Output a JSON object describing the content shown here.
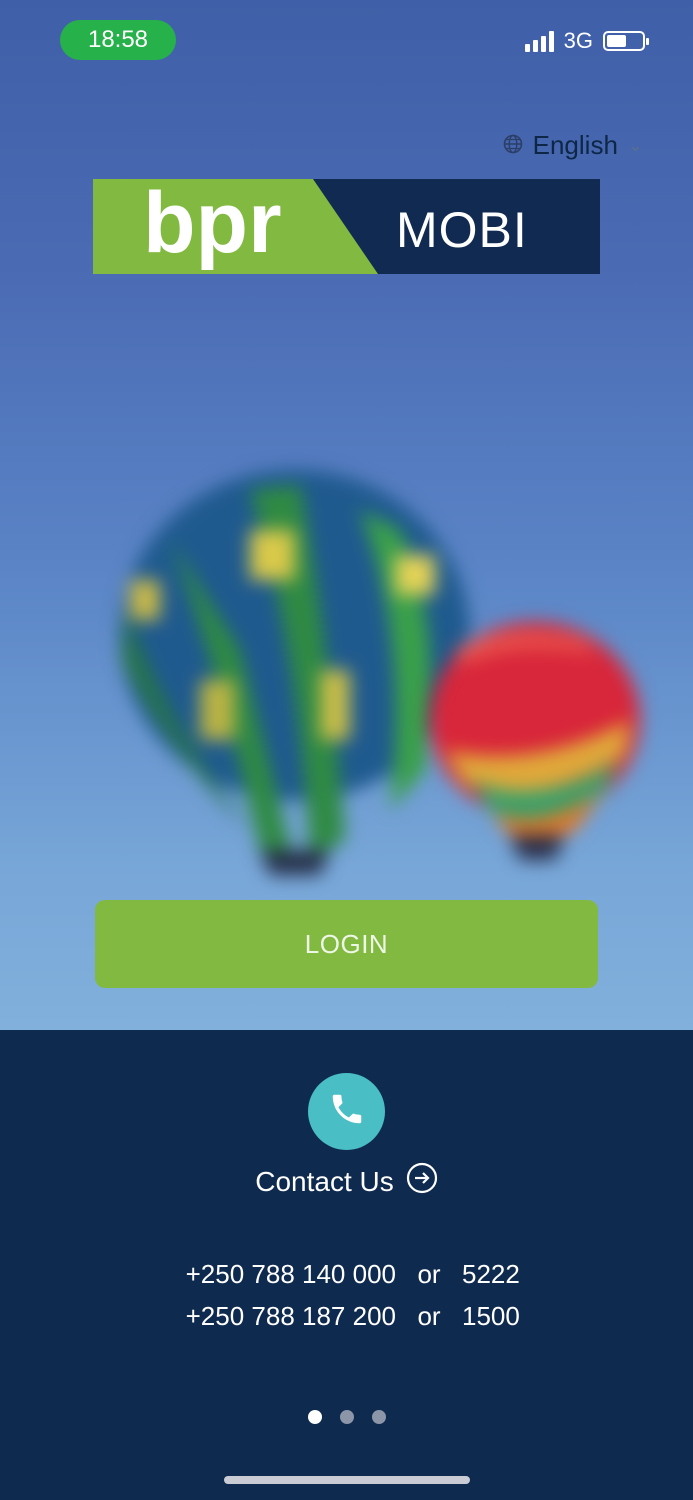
{
  "status_bar": {
    "time": "18:58",
    "network": "3G",
    "battery_level": 0.55
  },
  "language": {
    "icon": "globe-icon",
    "label": "English"
  },
  "logo": {
    "left_text": "bpr",
    "right_text": "MOBI"
  },
  "login": {
    "label": "LOGIN"
  },
  "contact": {
    "icon": "phone-icon",
    "label": "Contact Us",
    "arrow_icon": "arrow-right-circle-icon"
  },
  "phones": [
    {
      "number": "+250 788 140 000",
      "or": "or",
      "short": "5222"
    },
    {
      "number": "+250 788 187 200",
      "or": "or",
      "short": "1500"
    }
  ],
  "pager": {
    "count": 3,
    "active_index": 0
  },
  "colors": {
    "brand_green": "#82b941",
    "navy": "#0f2a4f",
    "teal": "#49bec4",
    "status_green": "#27b14a"
  }
}
